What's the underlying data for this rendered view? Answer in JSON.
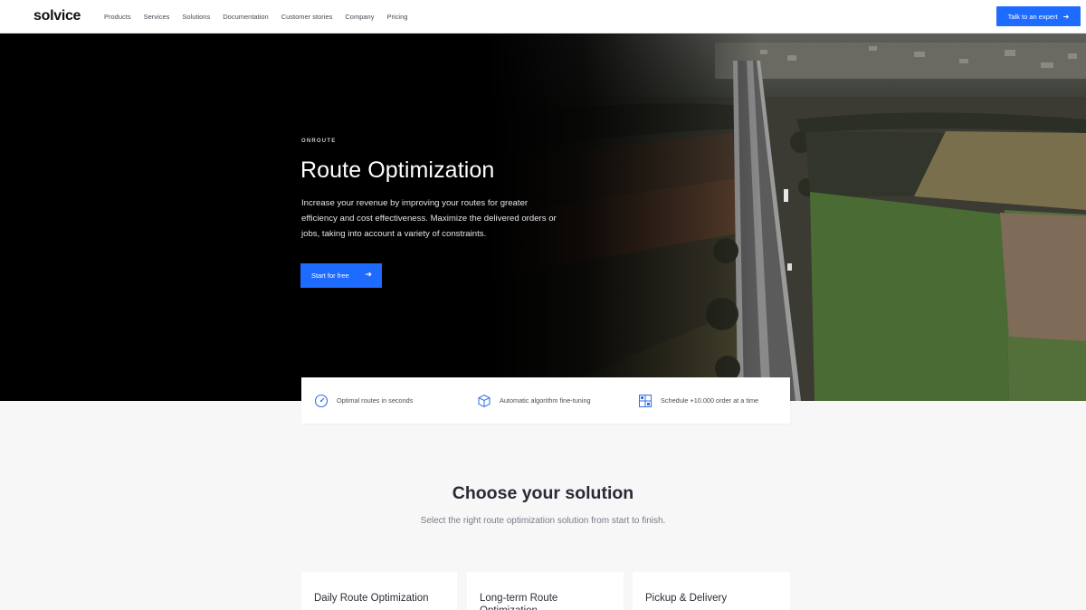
{
  "nav": {
    "logo": "solvice",
    "links": [
      "Products",
      "Services",
      "Solutions",
      "Documentation",
      "Customer stories",
      "Company",
      "Pricing"
    ],
    "cta": "Talk to an expert"
  },
  "hero": {
    "eyebrow": "ONROUTE",
    "title": "Route Optimization",
    "description": "Increase your revenue by improving your routes for greater efficiency and cost effectiveness. Maximize the delivered orders or jobs, taking into account a variety of constraints.",
    "cta": "Start for free"
  },
  "features": [
    {
      "icon": "speedometer-icon",
      "label": "Optimal routes in seconds"
    },
    {
      "icon": "cube-icon",
      "label": "Automatic algorithm fine-tuning"
    },
    {
      "icon": "schedule-grid-icon",
      "label": "Schedule +10.000 order at a time"
    }
  ],
  "section": {
    "title": "Choose your solution",
    "subtitle": "Select the right route optimization solution from start to finish."
  },
  "cards": [
    "Daily Route Optimization",
    "Long-term Route Optimization",
    "Pickup & Delivery"
  ],
  "colors": {
    "accent": "#1e6bff",
    "hero_bg": "#000000",
    "page_bg": "#f7f7f8"
  }
}
